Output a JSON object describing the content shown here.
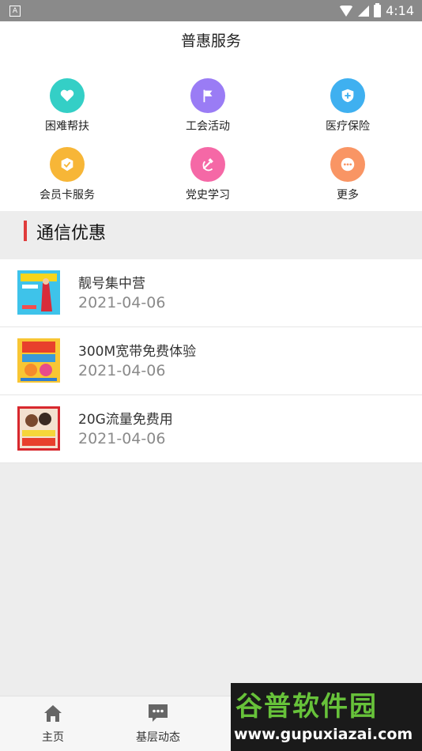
{
  "status_bar": {
    "left_badge": "A",
    "time": "4:14",
    "battery_icon": "battery-charging-icon",
    "wifi_icon": "wifi-icon",
    "signal_icon": "cell-signal-icon"
  },
  "page": {
    "title": "普惠服务"
  },
  "services": [
    {
      "label": "困难帮扶",
      "icon": "heart-hands-icon",
      "color": "#34cfc6"
    },
    {
      "label": "工会活动",
      "icon": "flag-icon",
      "color": "#9a7cf5"
    },
    {
      "label": "医疗保险",
      "icon": "medical-shield-icon",
      "color": "#3fb0f0"
    },
    {
      "label": "会员卡服务",
      "icon": "member-card-icon",
      "color": "#f7b637"
    },
    {
      "label": "党史学习",
      "icon": "hammer-sickle-icon",
      "color": "#f568a6"
    },
    {
      "label": "更多",
      "icon": "more-dots-icon",
      "color": "#f99564"
    }
  ],
  "section": {
    "title": "通信优惠",
    "accent": "#e03c3c"
  },
  "offers": [
    {
      "title": "靓号集中营",
      "date": "2021-04-06"
    },
    {
      "title": "300M宽带免费体验",
      "date": "2021-04-06"
    },
    {
      "title": "20G流量免费用",
      "date": "2021-04-06"
    }
  ],
  "tabs": [
    {
      "label": "主页",
      "icon": "home-icon"
    },
    {
      "label": "基层动态",
      "icon": "chat-bubble-icon"
    }
  ],
  "watermark": {
    "title": "谷普软件园",
    "url": "www.gupuxiazai.com"
  }
}
